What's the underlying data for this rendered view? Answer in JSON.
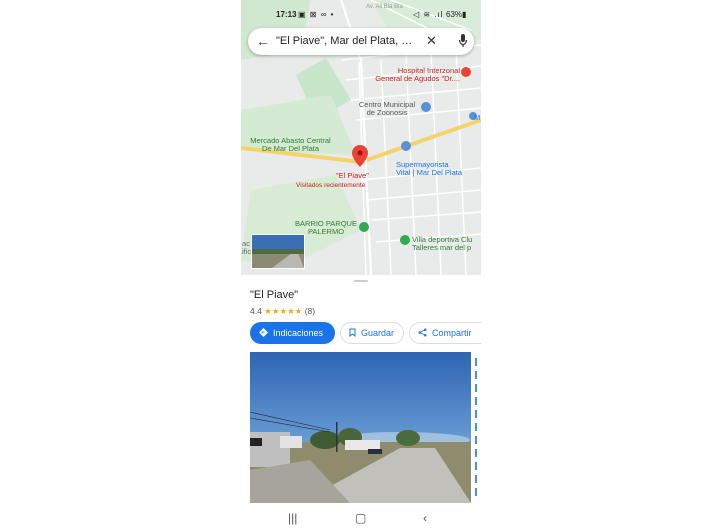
{
  "status_bar": {
    "time": "17:13",
    "left_icons": "▣ ⊠ ∞ •",
    "right_icons": "◁ ≋ .ıl",
    "battery": "63%▮"
  },
  "search": {
    "query": "\"El Piave\", Mar del Plata, P..."
  },
  "map_labels": {
    "hospital": "Hospital Interzonal\nGeneral de Agudos \"Dr....",
    "zoonosis": "Centro Municipal\nde Zoonosis",
    "mercado": "Mercado Abasto Central\nDe Mar Del Plata",
    "supermayorista": "Supermayorista\nVital | Mar Del Plata",
    "pin_name": "\"El Piave\"",
    "pin_sub": "Visitados recientemente",
    "barrio": "BARRIO PARQUE\nPALERMO",
    "villa": "Villa deportiva Clu\nTalleres mar del p",
    "edge_m": "M",
    "edge_ac": "ac\nific"
  },
  "place": {
    "name": "\"El Piave\"",
    "rating": "4.4",
    "stars": "★★★★★",
    "reviews": "(8)"
  },
  "actions": {
    "directions": "Indicaciones",
    "save": "Guardar",
    "share": "Compartir"
  },
  "colors": {
    "accent": "#1a73e8",
    "pin": "#ea4335",
    "star": "#f5a623"
  }
}
